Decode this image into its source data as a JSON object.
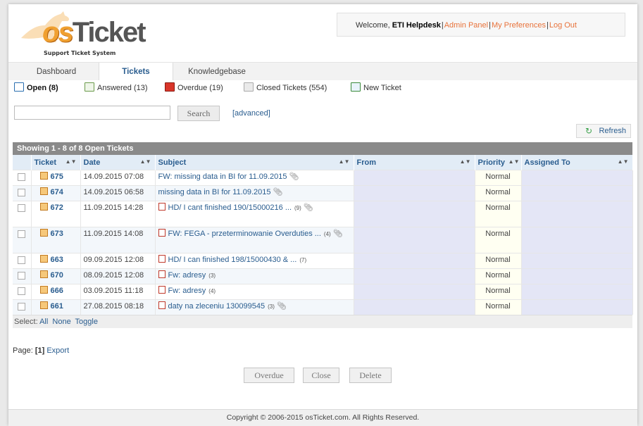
{
  "app": {
    "brand_os": "os",
    "brand_ticket": "Ticket",
    "tagline": "Support Ticket System"
  },
  "user": {
    "welcome": "Welcome,",
    "name": "ETI Helpdesk",
    "links": [
      "Admin Panel",
      "My Preferences",
      "Log Out"
    ]
  },
  "nav": {
    "tabs": [
      "Dashboard",
      "Tickets",
      "Knowledgebase"
    ],
    "active": "Tickets"
  },
  "subnav": {
    "items": [
      "Open (8)",
      "Answered (13)",
      "Overdue (19)",
      "Closed Tickets (554)",
      "New Ticket"
    ]
  },
  "search": {
    "placeholder": "",
    "button": "Search",
    "advanced": "[advanced]"
  },
  "refresh_label": "Refresh",
  "table": {
    "caption": "Showing  1 - 8 of 8  Open Tickets",
    "headers": [
      "Ticket",
      "Date",
      "Subject",
      "From",
      "Priority",
      "Assigned To"
    ],
    "rows": [
      {
        "ticket": "675",
        "date": "14.09.2015 07:08",
        "subject": "FW: missing data in BI for 11.09.2015",
        "thread_icon": false,
        "count": "",
        "clip": true,
        "priority": "Normal"
      },
      {
        "ticket": "674",
        "date": "14.09.2015 06:58",
        "subject": "missing data in BI for 11.09.2015",
        "thread_icon": false,
        "count": "",
        "clip": true,
        "priority": "Normal"
      },
      {
        "ticket": "672",
        "date": "11.09.2015 14:28",
        "subject": "HD/ I cant finished 190/15000216 ...",
        "thread_icon": true,
        "count": "(9)",
        "clip": true,
        "priority": "Normal"
      },
      {
        "ticket": "673",
        "date": "11.09.2015 14:08",
        "subject": "FW: FEGA - przeterminowanie Overduties ...",
        "thread_icon": true,
        "count": "(4)",
        "clip": true,
        "priority": "Normal"
      },
      {
        "ticket": "663",
        "date": "09.09.2015 12:08",
        "subject": "HD/ I can finished 198/15000430 & ...",
        "thread_icon": true,
        "count": "(7)",
        "clip": false,
        "priority": "Normal"
      },
      {
        "ticket": "670",
        "date": "08.09.2015 12:08",
        "subject": "Fw: adresy",
        "thread_icon": true,
        "count": "(3)",
        "clip": false,
        "priority": "Normal"
      },
      {
        "ticket": "666",
        "date": "03.09.2015 11:18",
        "subject": "Fw: adresy",
        "thread_icon": true,
        "count": "(4)",
        "clip": false,
        "priority": "Normal"
      },
      {
        "ticket": "661",
        "date": "27.08.2015 08:18",
        "subject": "daty na zleceniu 130099545",
        "thread_icon": true,
        "count": "(3)",
        "clip": true,
        "priority": "Normal"
      }
    ]
  },
  "select": {
    "label": "Select:",
    "options": [
      "All",
      "None",
      "Toggle"
    ]
  },
  "pager": {
    "label": "Page:",
    "current": "[1]",
    "export": "Export"
  },
  "actions": [
    "Overdue",
    "Close",
    "Delete"
  ],
  "footer": "Copyright © 2006-2015 osTicket.com.  All Rights Reserved."
}
